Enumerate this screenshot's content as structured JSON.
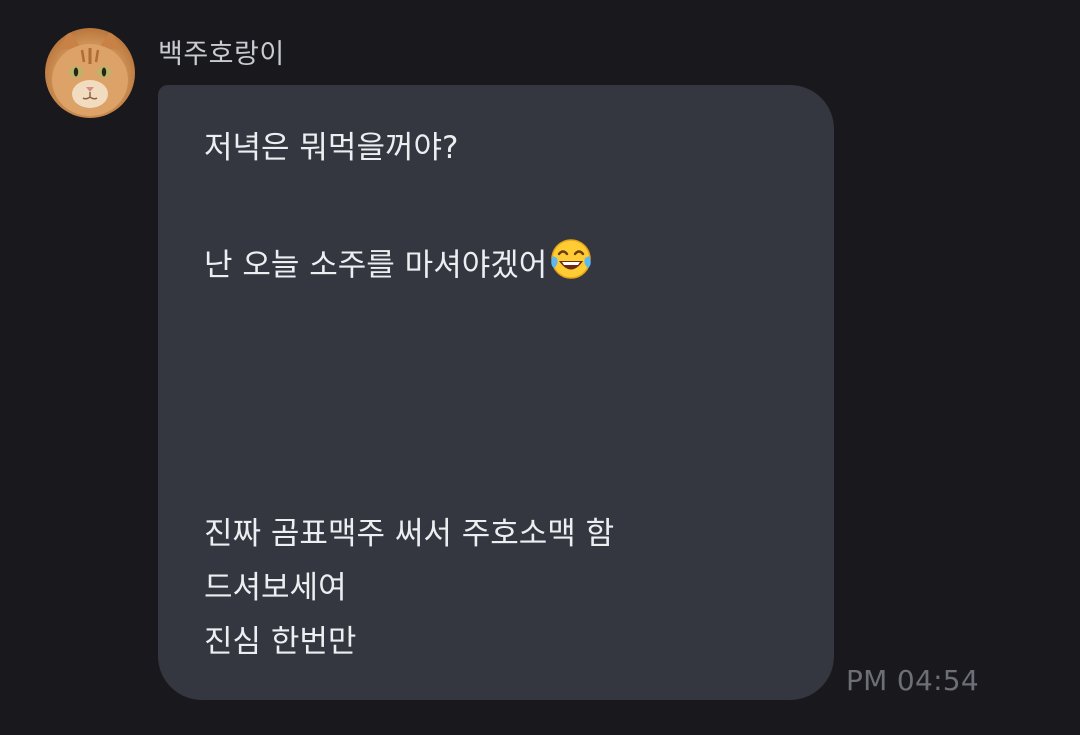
{
  "sender": {
    "name": "백주호랑이",
    "avatar": "cat-photo-avatar"
  },
  "message": {
    "lines": [
      "저녁은 뭐먹을꺼야?",
      "난 오늘 소주를 마셔야겠어",
      "진짜 곰표맥주 써서 주호소맥 함",
      "드셔보세여",
      "진심 한번만"
    ],
    "emoji": "tears-of-joy-emoji",
    "timestamp": "PM 04:54"
  },
  "colors": {
    "background": "#19191d",
    "bubble": "#34373f",
    "text": "#eceef1",
    "sender_name": "#c9cbd0",
    "timestamp": "#6c6f76"
  }
}
